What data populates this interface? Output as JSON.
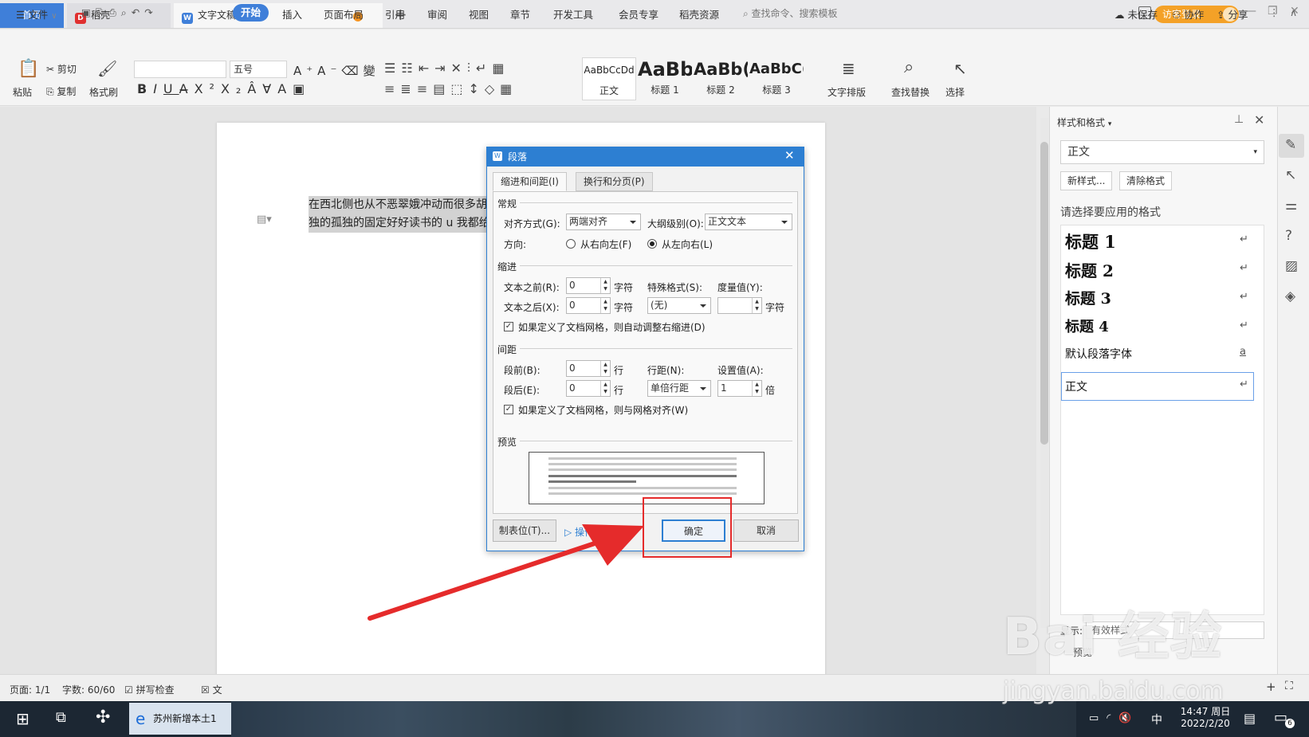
{
  "tabs": {
    "home": "首页",
    "daoke": "稻壳",
    "doc": "文字文稿1",
    "visitor_login": "访客登录"
  },
  "menu": {
    "file": "文件",
    "items": [
      "开始",
      "插入",
      "页面布局",
      "引用",
      "审阅",
      "视图",
      "章节",
      "开发工具",
      "会员专享",
      "稻壳资源"
    ],
    "search": "查找命令、搜索模板",
    "unsaved": "未保存",
    "collab": "协作",
    "share": "分享"
  },
  "ribbon": {
    "paste": "粘贴",
    "cut": "剪切",
    "copy": "复制",
    "format_painter": "格式刷",
    "font_size": "五号",
    "styles": [
      {
        "sample": "AaBbCcDd",
        "label": "正文"
      },
      {
        "sample": "AaBb",
        "label": "标题 1"
      },
      {
        "sample": "AaBb(",
        "label": "标题 2"
      },
      {
        "sample": "AaBbC(",
        "label": "标题 3"
      }
    ],
    "text_layout": "文字排版",
    "find_replace": "查找替换",
    "select": "选择"
  },
  "document": {
    "line1": "在西北侧也从不恶翠娥冲动而很多胡适",
    "line2": "独的孤独的固定好好读书的 u 我都给你"
  },
  "panel": {
    "title": "样式和格式",
    "current_style": "正文",
    "new_style": "新样式...",
    "clear_format": "清除格式",
    "prompt": "请选择要应用的格式",
    "styles": [
      "标题 1",
      "标题 2",
      "标题 3",
      "标题 4",
      "默认段落字体",
      "正文"
    ],
    "show_label": "显示:",
    "show_value": "有效样式",
    "preview": "预览"
  },
  "status": {
    "page": "页面: 1/1",
    "words": "字数: 60/60",
    "spell": "拼写检查",
    "doc": "文"
  },
  "taskbar": {
    "ie_title": "苏州新增本土1",
    "time": "14:47 周日",
    "date": "2022/2/20",
    "ime": "中",
    "notif": "6"
  },
  "dialog": {
    "title": "段落",
    "tab_indent": "缩进和间距(I)",
    "tab_break": "换行和分页(P)",
    "sec_general": "常规",
    "align_label": "对齐方式(G):",
    "align_value": "两端对齐",
    "outline_label": "大纲级别(O):",
    "outline_value": "正文文本",
    "direction_label": "方向:",
    "rtl": "从右向左(F)",
    "ltr": "从左向右(L)",
    "sec_indent": "缩进",
    "before_text_label": "文本之前(R):",
    "before_text_value": "0",
    "after_text_label": "文本之后(X):",
    "after_text_value": "0",
    "unit_char": "字符",
    "special_label": "特殊格式(S):",
    "special_value": "(无)",
    "measure_label": "度量值(Y):",
    "measure_value": "",
    "auto_indent": "如果定义了文档网格，则自动调整右缩进(D)",
    "sec_spacing": "间距",
    "before_label": "段前(B):",
    "before_value": "0",
    "after_label": "段后(E):",
    "after_value": "0",
    "unit_line": "行",
    "line_spacing_label": "行距(N):",
    "line_spacing_value": "单倍行距",
    "set_value_label": "设置值(A):",
    "set_value": "1",
    "unit_times": "倍",
    "grid_align": "如果定义了文档网格，则与网格对齐(W)",
    "preview": "预览",
    "tabs_btn": "制表位(T)...",
    "tips": "操作技巧",
    "ok": "确定",
    "cancel": "取消"
  },
  "watermark": {
    "brand": "Bai 经验",
    "url": "jingyan.baidu.com"
  },
  "colors": {
    "accent": "#3f7fd9",
    "dialog_title": "#2d7fd2",
    "annotation": "#e52b2b",
    "visitor": "#f4a127"
  }
}
